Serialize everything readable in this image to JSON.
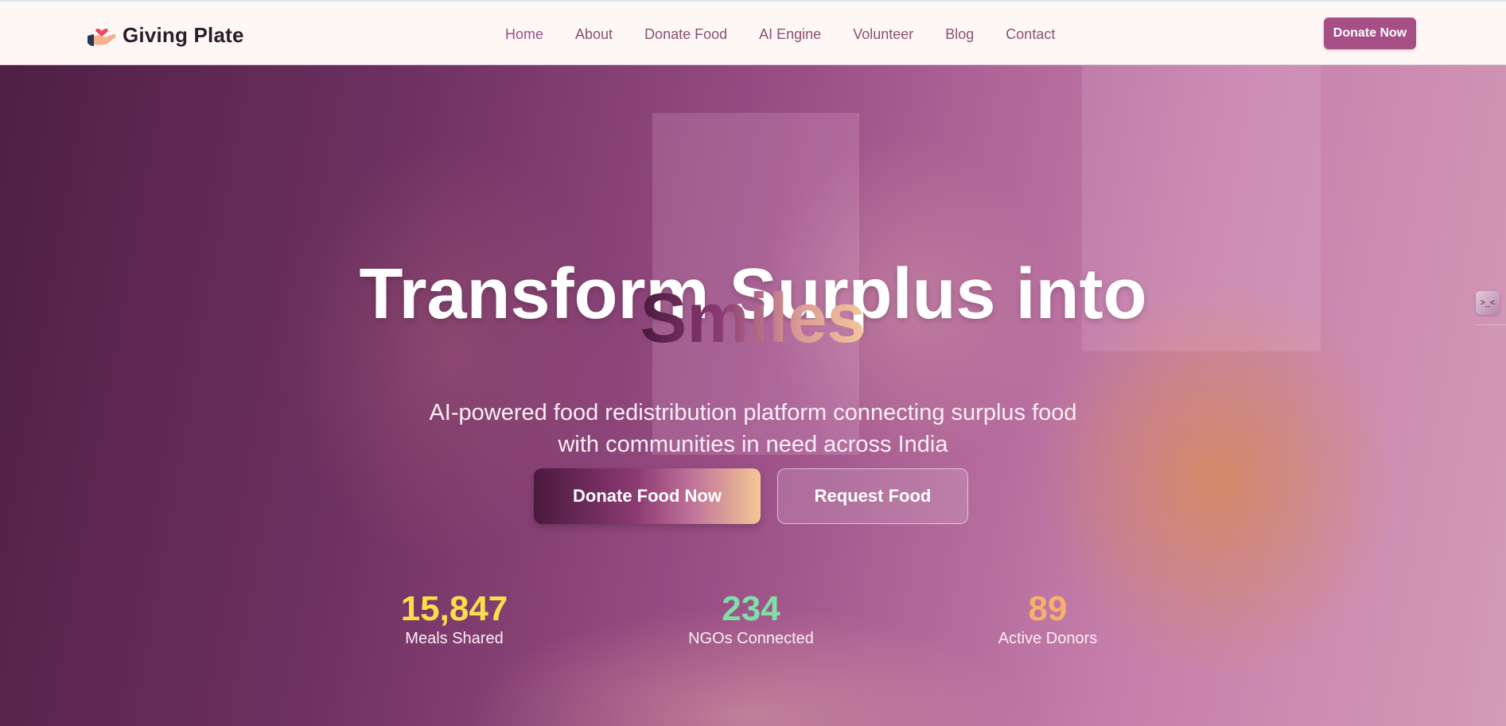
{
  "brand": {
    "name": "Giving Plate",
    "logo_icon": "hand-heart-icon"
  },
  "nav": {
    "items": [
      {
        "label": "Home",
        "active": true
      },
      {
        "label": "About"
      },
      {
        "label": "Donate Food"
      },
      {
        "label": "AI Engine"
      },
      {
        "label": "Volunteer"
      },
      {
        "label": "Blog"
      },
      {
        "label": "Contact"
      }
    ],
    "cta_label": "Donate Now"
  },
  "hero": {
    "title": "Transform Surplus into",
    "title_accent": "Smiles",
    "subtitle": "AI-powered food redistribution platform connecting surplus food with communities in need across India",
    "primary_button": "Donate Food Now",
    "secondary_button": "Request Food"
  },
  "stats": [
    {
      "value": "15,847",
      "label": "Meals Shared",
      "color": "#f9e04b"
    },
    {
      "value": "234",
      "label": "NGOs Connected",
      "color": "#7ee0a8"
    },
    {
      "value": "89",
      "label": "Active Donors",
      "color": "#f6b06a"
    }
  ],
  "side_widget": {
    "icon": "terminal-icon",
    "glyph": ">_<"
  },
  "colors": {
    "nav_text": "#8a4f75",
    "brand_text": "#2c1c2b",
    "cta_bg": "#a64f86"
  }
}
